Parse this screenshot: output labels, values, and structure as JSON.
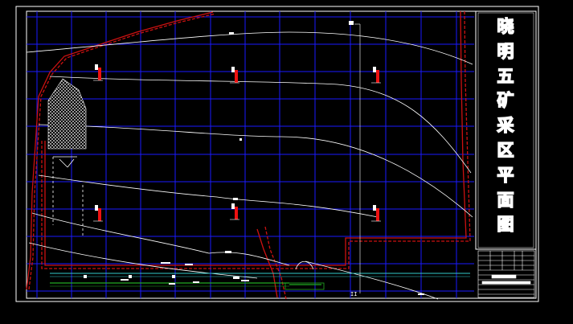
{
  "drawing": {
    "title": "晓明五矿采区平面图",
    "title_chars": [
      "晓",
      "明",
      "五",
      "矿",
      "采",
      "区",
      "平",
      "面",
      "图"
    ],
    "sheet_label": "II"
  },
  "colors": {
    "background": "#000000",
    "grid": "#1a1aff",
    "boundary": "#cc1111",
    "contour": "#ffffff",
    "frame": "#ffffff",
    "channel": "#33cccc",
    "rail": "#22aa22"
  }
}
